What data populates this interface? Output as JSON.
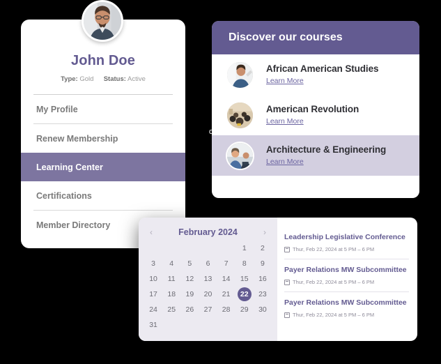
{
  "theme": {
    "page_background": "#000000",
    "accent_purple": "#635b91",
    "active_item_purple": "#7d75a0",
    "highlight_lavender": "#d3cfe0",
    "calendar_background": "#eceaf1"
  },
  "profile": {
    "avatar_icon": "user-photo-avatar",
    "name": "John Doe",
    "type_label": "Type:",
    "type_value": "Gold",
    "status_label": "Status:",
    "status_value": "Active",
    "menu": [
      {
        "label": "My Profile",
        "active": false
      },
      {
        "label": "Renew Membership",
        "active": false
      },
      {
        "label": "Learning Center",
        "active": true
      },
      {
        "label": "Certifications",
        "active": false
      },
      {
        "label": "Member Directory",
        "active": false
      }
    ]
  },
  "courses": {
    "header": "Discover our courses",
    "items": [
      {
        "title": "African American Studies",
        "link": "Learn More",
        "thumb_icon": "course-photo-thumbnail",
        "highlight": false
      },
      {
        "title": "American Revolution",
        "link": "Learn More",
        "thumb_icon": "course-photo-thumbnail",
        "highlight": false
      },
      {
        "title": "Architecture & Engineering",
        "link": "Learn More",
        "thumb_icon": "course-photo-thumbnail",
        "highlight": true
      }
    ],
    "stray_glyph": "o"
  },
  "calendar": {
    "prev_icon": "chevron-left-icon",
    "next_icon": "chevron-right-icon",
    "title": "February 2024",
    "selected_day": 22,
    "leading_blanks": 5,
    "days": [
      1,
      2,
      3,
      4,
      5,
      6,
      7,
      8,
      9,
      10,
      11,
      12,
      13,
      14,
      15,
      16,
      17,
      18,
      19,
      20,
      21,
      22,
      23,
      24,
      25,
      26,
      27,
      28,
      29,
      30,
      31
    ]
  },
  "events": [
    {
      "title": "Leadership Legislative Conference",
      "when": "Thur, Feb 22, 2024 at 5 PM – 6 PM",
      "icon": "calendar-icon"
    },
    {
      "title": "Payer Relations MW Subcommittee",
      "when": "Thur, Feb 22, 2024 at 5 PM – 6 PM",
      "icon": "calendar-icon"
    },
    {
      "title": "Payer Relations MW Subcommittee",
      "when": "Thur, Feb 22, 2024 at 5 PM – 6 PM",
      "icon": "calendar-icon"
    }
  ]
}
